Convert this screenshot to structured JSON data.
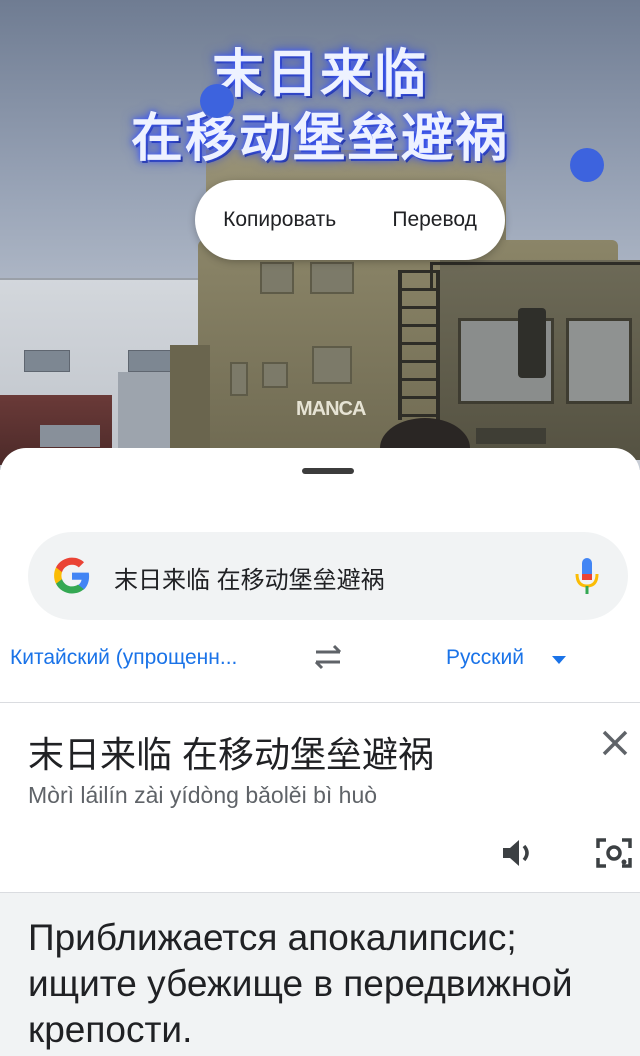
{
  "overlay": {
    "title_line1": "末日来临",
    "title_line2": "在移动堡垒避祸",
    "truck_logo": "MANCA"
  },
  "context_menu": {
    "copy_label": "Копировать",
    "translate_label": "Перевод"
  },
  "search": {
    "query": "末日来临 在移动堡垒避祸"
  },
  "languages": {
    "source": "Китайский (упрощенн...",
    "target": "Русский"
  },
  "translation": {
    "source_text": "末日来临 在移动堡垒避祸",
    "romanization": "Mòrì láilín zài yídòng bǎolěi bì huò",
    "result_text": "Приближается апокалипсис; ищите убежище в передвижной крепости."
  },
  "icons": {
    "google_logo": "google-g-icon",
    "mic": "mic-icon",
    "swap": "swap-icon",
    "close": "close-icon",
    "speaker": "speaker-icon",
    "lens": "lens-icon"
  },
  "colors": {
    "accent_blue": "#1a73e8",
    "selection_handle": "#3d63de",
    "panel_gray": "#f1f3f4"
  }
}
